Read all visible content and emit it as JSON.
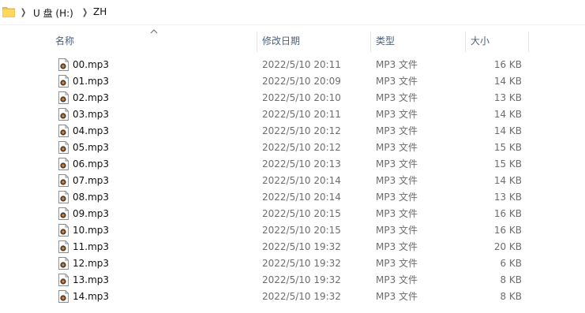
{
  "breadcrumb": {
    "items": [
      "U 盘 (H:)",
      "ZH"
    ]
  },
  "columns": {
    "name": "名称",
    "date": "修改日期",
    "type": "类型",
    "size": "大小"
  },
  "colors": {
    "header_text": "#4c607a",
    "secondary_text": "#6d6d6d",
    "folder_yellow": "#f5c342"
  },
  "files": [
    {
      "name": "00.mp3",
      "date": "2022/5/10 20:11",
      "type": "MP3 文件",
      "size": "16 KB"
    },
    {
      "name": "01.mp3",
      "date": "2022/5/10 20:09",
      "type": "MP3 文件",
      "size": "14 KB"
    },
    {
      "name": "02.mp3",
      "date": "2022/5/10 20:10",
      "type": "MP3 文件",
      "size": "13 KB"
    },
    {
      "name": "03.mp3",
      "date": "2022/5/10 20:11",
      "type": "MP3 文件",
      "size": "14 KB"
    },
    {
      "name": "04.mp3",
      "date": "2022/5/10 20:12",
      "type": "MP3 文件",
      "size": "14 KB"
    },
    {
      "name": "05.mp3",
      "date": "2022/5/10 20:12",
      "type": "MP3 文件",
      "size": "15 KB"
    },
    {
      "name": "06.mp3",
      "date": "2022/5/10 20:13",
      "type": "MP3 文件",
      "size": "15 KB"
    },
    {
      "name": "07.mp3",
      "date": "2022/5/10 20:14",
      "type": "MP3 文件",
      "size": "14 KB"
    },
    {
      "name": "08.mp3",
      "date": "2022/5/10 20:14",
      "type": "MP3 文件",
      "size": "13 KB"
    },
    {
      "name": "09.mp3",
      "date": "2022/5/10 20:15",
      "type": "MP3 文件",
      "size": "16 KB"
    },
    {
      "name": "10.mp3",
      "date": "2022/5/10 20:15",
      "type": "MP3 文件",
      "size": "16 KB"
    },
    {
      "name": "11.mp3",
      "date": "2022/5/10 19:32",
      "type": "MP3 文件",
      "size": "20 KB"
    },
    {
      "name": "12.mp3",
      "date": "2022/5/10 19:32",
      "type": "MP3 文件",
      "size": "6 KB"
    },
    {
      "name": "13.mp3",
      "date": "2022/5/10 19:32",
      "type": "MP3 文件",
      "size": "8 KB"
    },
    {
      "name": "14.mp3",
      "date": "2022/5/10 19:32",
      "type": "MP3 文件",
      "size": "8 KB"
    }
  ]
}
